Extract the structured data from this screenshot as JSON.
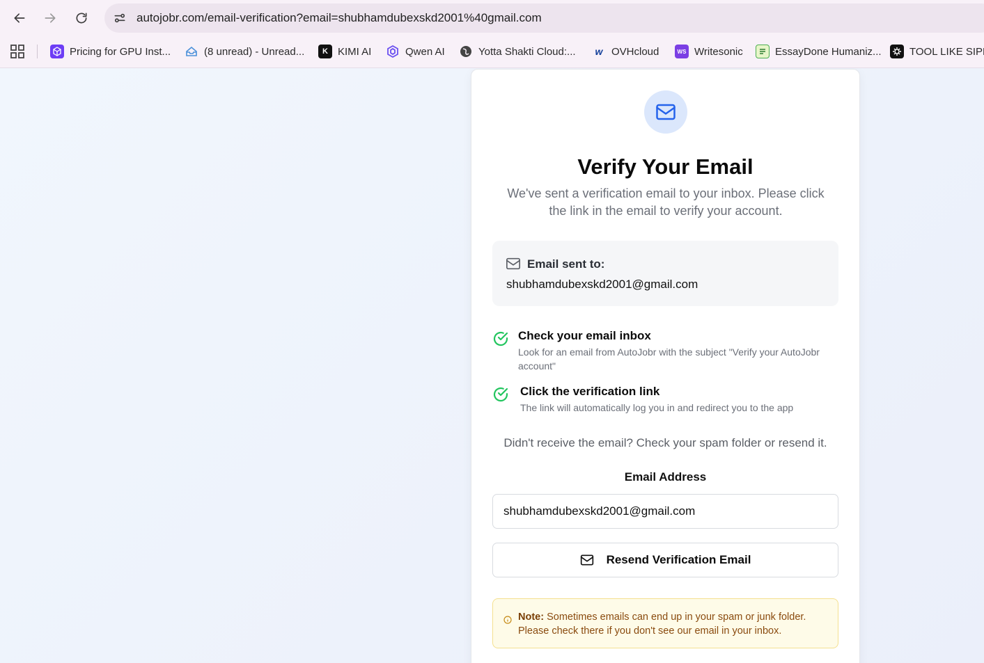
{
  "browser": {
    "url": "autojobr.com/email-verification?email=shubhamdubexskd2001%40gmail.com",
    "bookmarks": [
      {
        "label": "Pricing for GPU Inst...",
        "icon": "cube-icon",
        "color": "#6d3df5"
      },
      {
        "label": "(8 unread) - Unread...",
        "icon": "mail-tray-icon",
        "color": "#4a90d9"
      },
      {
        "label": "KIMI AI",
        "icon": "kimi-k-icon",
        "color": "#111111"
      },
      {
        "label": "Qwen AI",
        "icon": "qwen-icon",
        "color": "#6a4ff0"
      },
      {
        "label": "Yotta Shakti Cloud:...",
        "icon": "globe-icon",
        "color": "#444444"
      },
      {
        "label": "OVHcloud",
        "icon": "ovh-icon",
        "color": "#123f9a"
      },
      {
        "label": "Writesonic",
        "icon": "writesonic-icon",
        "color": "#7b3fe4"
      },
      {
        "label": "EssayDone Humaniz...",
        "icon": "essaydone-icon",
        "color": "#4caf50"
      },
      {
        "label": "TOOL LIKE SIPLY",
        "icon": "tool-icon",
        "color": "#111111"
      }
    ]
  },
  "card": {
    "title": "Verify Your Email",
    "subtitle": "We've sent a verification email to your inbox. Please click the link in the email to verify your account.",
    "sent_label": "Email sent to:",
    "sent_email": "shubhamdubexskd2001@gmail.com",
    "steps": [
      {
        "title": "Check your email inbox",
        "desc": "Look for an email from AutoJobr with the subject \"Verify your AutoJobr account\""
      },
      {
        "title": "Click the verification link",
        "desc": "The link will automatically log you in and redirect you to the app"
      }
    ],
    "resend_hint": "Didn't receive the email? Check your spam folder or resend it.",
    "field_label": "Email Address",
    "email_value": "shubhamdubexskd2001@gmail.com",
    "resend_button": "Resend Verification Email",
    "note_label": "Note:",
    "note_text": " Sometimes emails can end up in your spam or junk folder. Please check there if you don't see our email in your inbox."
  },
  "colors": {
    "accent": "#2563eb",
    "success": "#22c55e",
    "warning_text": "#8a4b0f"
  }
}
